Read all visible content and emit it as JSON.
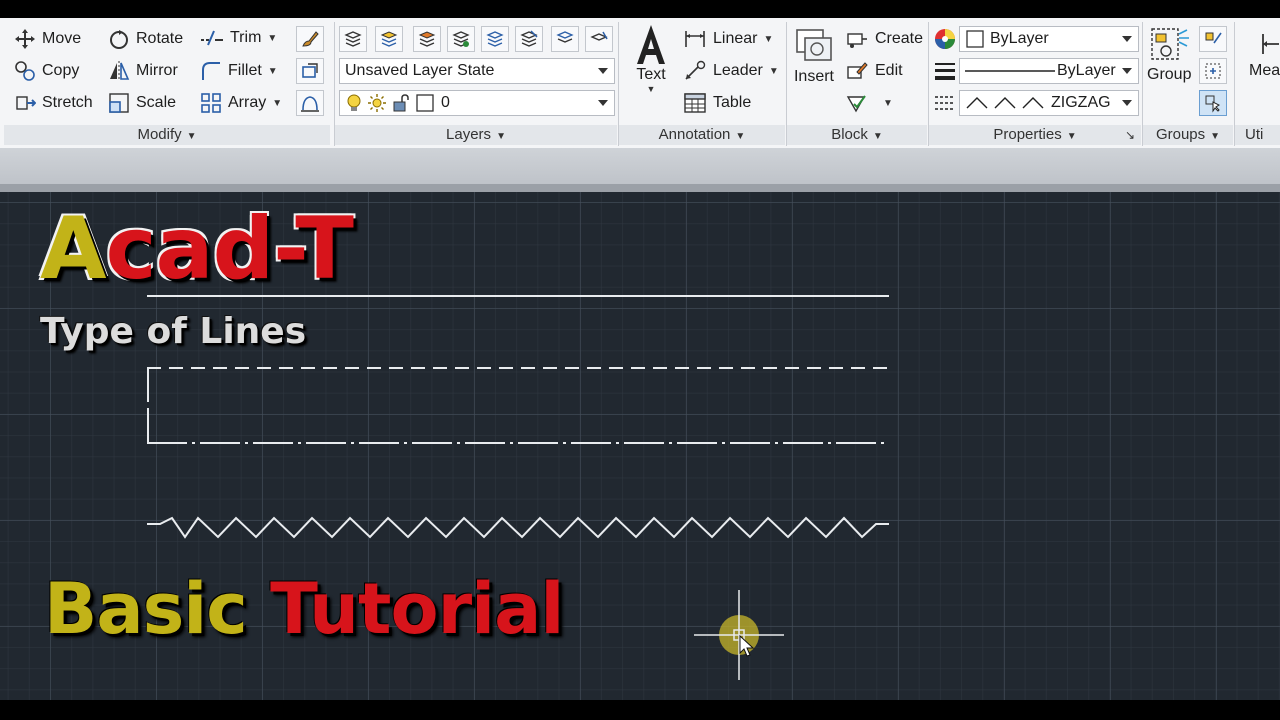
{
  "ribbon": {
    "modify": {
      "title": "Modify",
      "move": "Move",
      "rotate": "Rotate",
      "trim": "Trim",
      "copy": "Copy",
      "mirror": "Mirror",
      "fillet": "Fillet",
      "stretch": "Stretch",
      "scale": "Scale",
      "array": "Array"
    },
    "layers": {
      "title": "Layers",
      "layer_state": "Unsaved Layer State",
      "current_layer": "0"
    },
    "annotation": {
      "title": "Annotation",
      "text": "Text",
      "linear": "Linear",
      "leader": "Leader",
      "table": "Table"
    },
    "block": {
      "title": "Block",
      "insert": "Insert",
      "create": "Create",
      "edit": "Edit"
    },
    "properties": {
      "title": "Properties",
      "color": "ByLayer",
      "lineweight": "ByLayer",
      "linetype": "ZIGZAG"
    },
    "groups": {
      "title": "Groups",
      "group": "Group"
    },
    "utilities": {
      "title": "Uti",
      "measure": "Mea"
    }
  },
  "overlay": {
    "title_first_letter": "A",
    "title_rest": "cad-T",
    "subtitle": "Type of Lines",
    "footer_word1": "Basic",
    "footer_word2": "Tutorial"
  },
  "colors": {
    "canvas_bg": "#212830",
    "title_yellow": "#c2b318",
    "title_red": "#d7141b",
    "cursor_highlight": "#c7b52a"
  }
}
